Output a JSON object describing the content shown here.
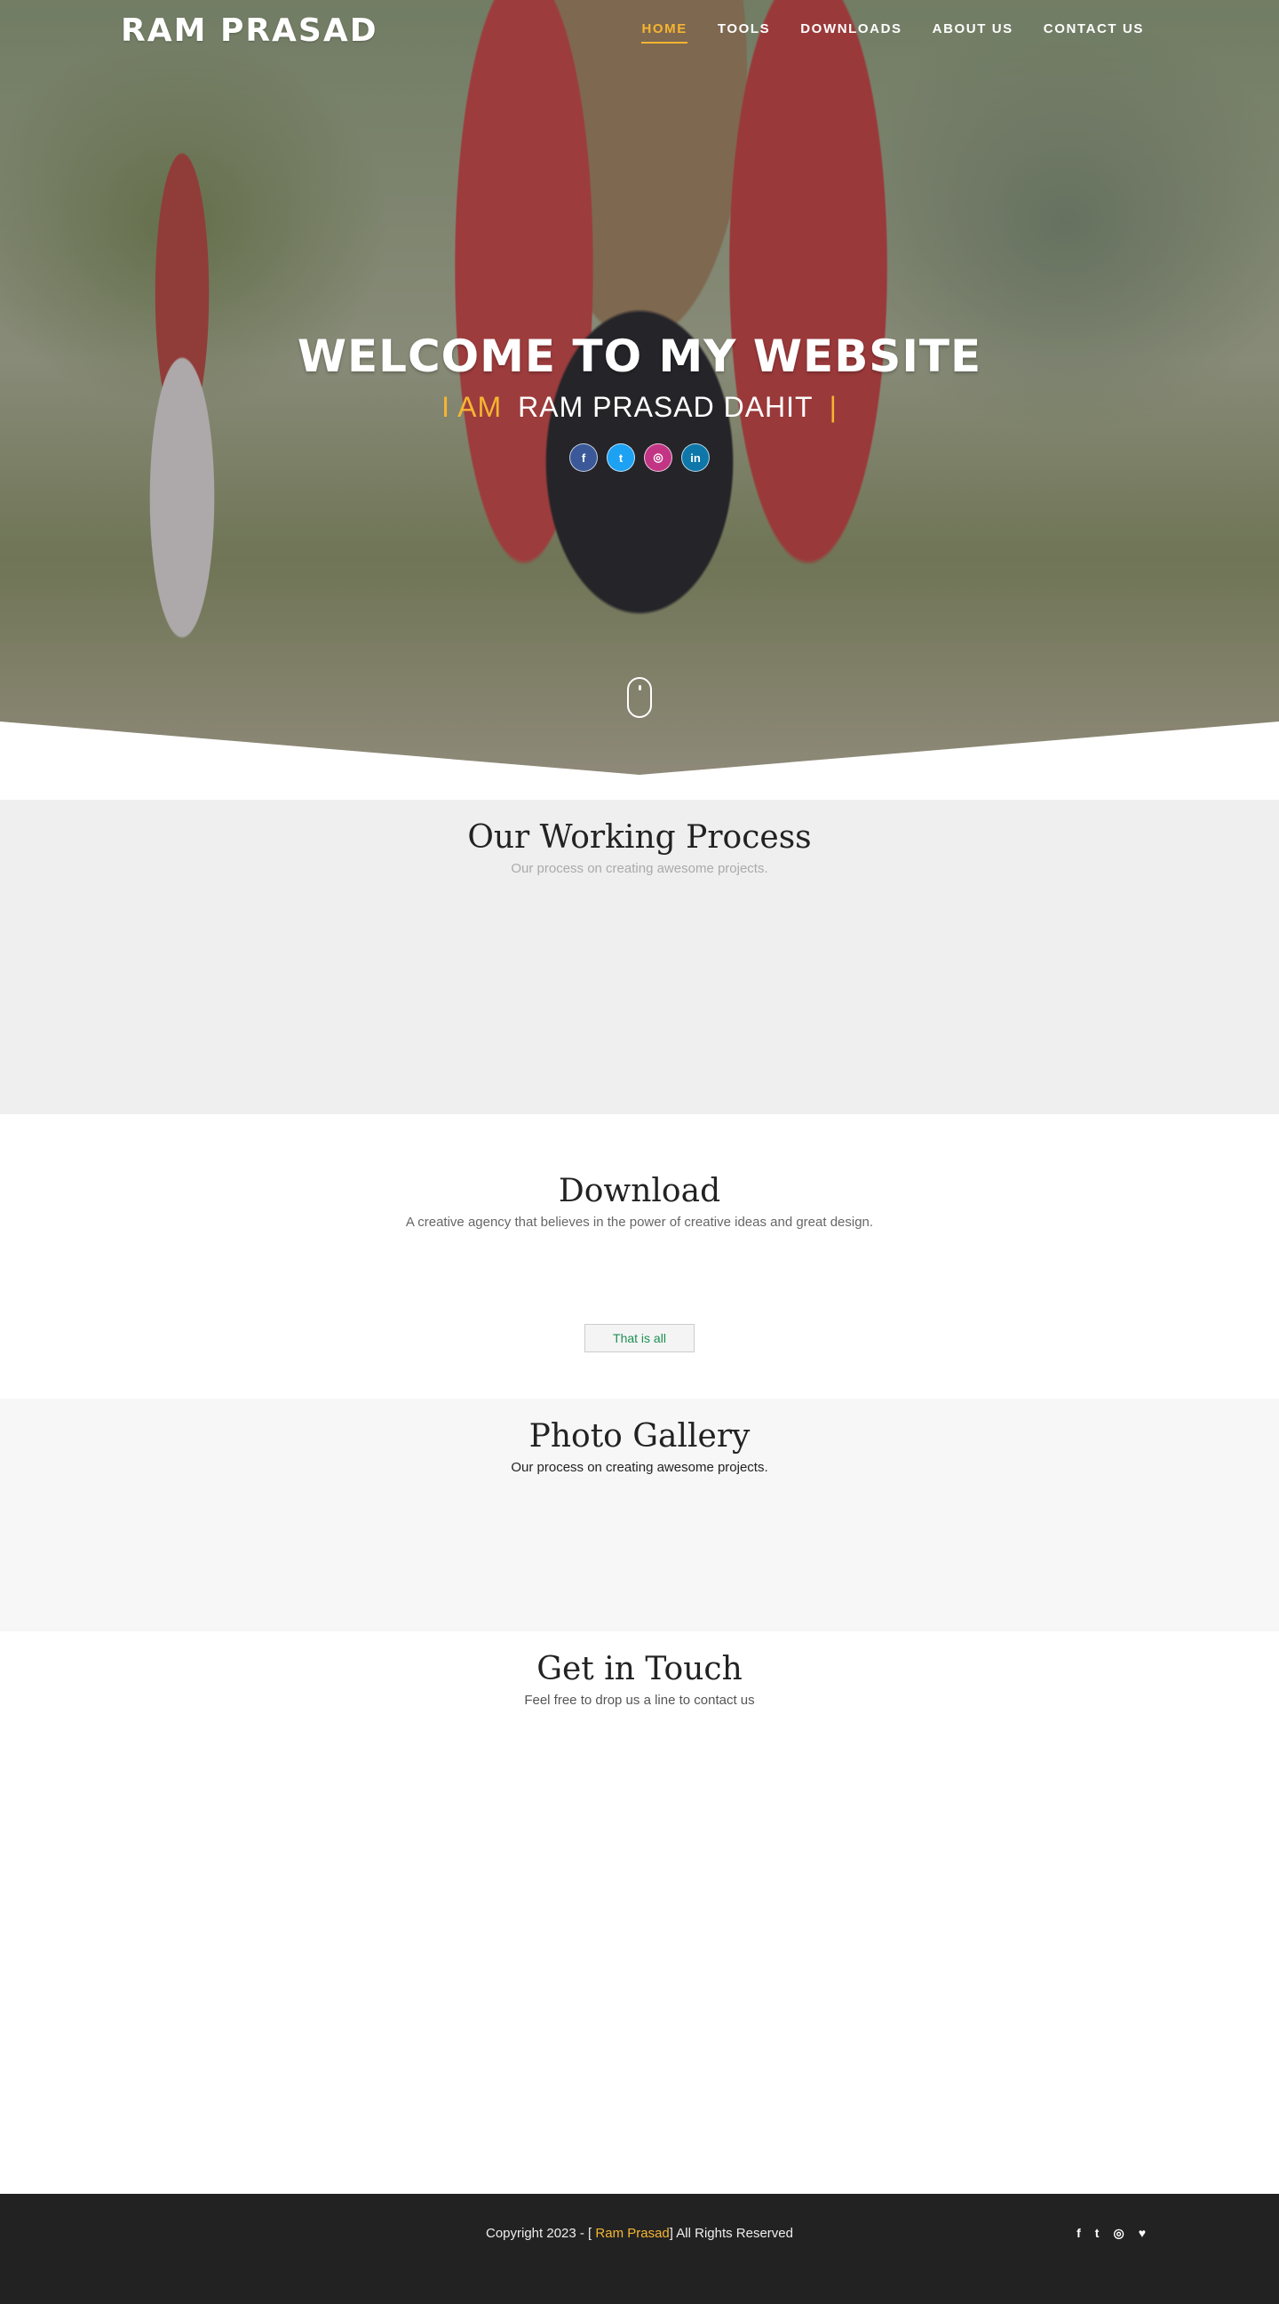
{
  "nav": {
    "brand": "RAM PRASAD",
    "items": [
      {
        "label": "HOME",
        "active": true
      },
      {
        "label": "TOOLS"
      },
      {
        "label": "DOWNLOADS"
      },
      {
        "label": "ABOUT US"
      },
      {
        "label": "CONTACT US"
      }
    ]
  },
  "hero": {
    "title": "WELCOME TO MY WEBSITE",
    "prefix": "I AM",
    "name": "RAM PRASAD DAHIT",
    "cursor": "|",
    "social": [
      {
        "icon": "facebook-icon",
        "glyph": "f",
        "color": "#3b5998"
      },
      {
        "icon": "twitter-icon",
        "glyph": "t",
        "color": "#1da1f2"
      },
      {
        "icon": "instagram-icon",
        "glyph": "◎",
        "color": "#c13584"
      },
      {
        "icon": "linkedin-icon",
        "glyph": "in",
        "color": "#0e76a8"
      }
    ]
  },
  "process": {
    "title": "Our Working Process",
    "subtitle": "Our process on creating awesome projects."
  },
  "download": {
    "title": "Download",
    "subtitle": "A creative agency that believes in the power of creative ideas and great design.",
    "button": "That is all"
  },
  "gallery": {
    "title": "Photo Gallery",
    "subtitle": "Our process on creating awesome projects."
  },
  "contact": {
    "title": "Get in Touch",
    "subtitle": "Feel free to drop us a line to contact us"
  },
  "footer": {
    "copy_prefix": "Copyright 2023 - [ ",
    "copy_name": "Ram Prasad",
    "copy_suffix": "] All Rights Reserved",
    "icons": [
      {
        "icon": "facebook-icon",
        "glyph": "f"
      },
      {
        "icon": "twitter-icon",
        "glyph": "t"
      },
      {
        "icon": "instagram-icon",
        "glyph": "◎"
      },
      {
        "icon": "heart-icon",
        "glyph": "♥"
      }
    ]
  },
  "colors": {
    "accent": "#f6b531",
    "footer_bg": "#222222",
    "process_bg": "#efefef",
    "button_text": "#1e8f55"
  }
}
